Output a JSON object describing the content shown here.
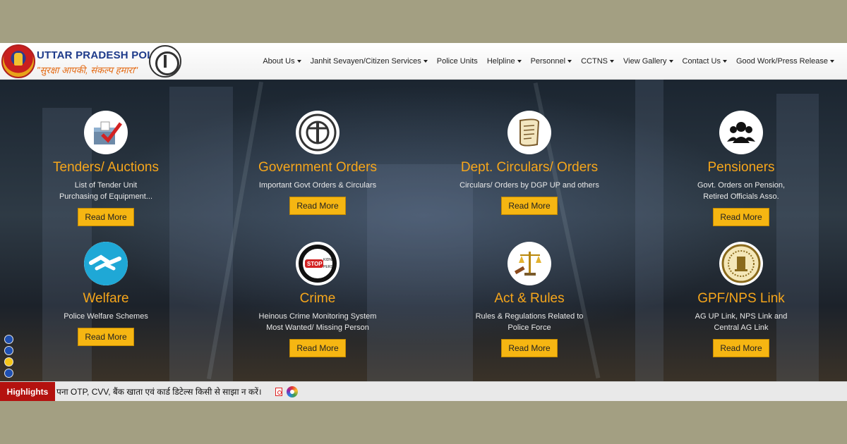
{
  "header": {
    "logo_title": "UTTAR PRADESH POLICE",
    "logo_tagline": "\"सुरक्षा आपकी, संकल्प हमारा\"",
    "nav": [
      {
        "label": "About Us",
        "dropdown": true
      },
      {
        "label": "Janhit Sevayen/Citizen Services",
        "dropdown": true
      },
      {
        "label": "Police Units",
        "dropdown": false
      },
      {
        "label": "Helpline",
        "dropdown": true
      },
      {
        "label": "Personnel",
        "dropdown": true
      },
      {
        "label": "CCTNS",
        "dropdown": true
      },
      {
        "label": "View Gallery",
        "dropdown": true
      },
      {
        "label": "Contact Us",
        "dropdown": true
      },
      {
        "label": "Good Work/Press Release",
        "dropdown": true
      }
    ]
  },
  "cards": [
    {
      "title": "Tenders/ Auctions",
      "desc": [
        "List of Tender Unit",
        "Purchasing of Equipment..."
      ],
      "button": "Read More",
      "icon": "ballot-box-icon"
    },
    {
      "title": "Government Orders",
      "desc": [
        "Important Govt Orders & Circulars"
      ],
      "button": "Read More",
      "icon": "police-seal-icon"
    },
    {
      "title": "Dept. Circulars/ Orders",
      "desc": [
        "Circulars/ Orders by DGP UP and others"
      ],
      "button": "Read More",
      "icon": "scroll-icon"
    },
    {
      "title": "Pensioners",
      "desc": [
        "Govt. Orders on Pension,",
        "Retired Officials Asso."
      ],
      "button": "Read More",
      "icon": "users-icon"
    },
    {
      "title": "Welfare",
      "desc": [
        "Police Welfare Schemes"
      ],
      "button": "Read More",
      "icon": "handshake-icon"
    },
    {
      "title": "Crime",
      "desc": [
        "Heinous Crime Monitoring System",
        "Most Wanted/ Missing Person"
      ],
      "button": "Read More",
      "icon": "stop-sign-icon"
    },
    {
      "title": "Act & Rules",
      "desc": [
        "Rules & Regulations Related to",
        "Police Force"
      ],
      "button": "Read More",
      "icon": "scales-gavel-icon"
    },
    {
      "title": "GPF/NPS Link",
      "desc": [
        "AG UP Link, NPS Link and",
        "Central AG Link"
      ],
      "button": "Read More",
      "icon": "emblem-seal-icon"
    }
  ],
  "slider_dots": 4,
  "slider_active": 3,
  "highlights": {
    "label": "Highlights",
    "text": "पना OTP, CVV, बैंक खाता एवं कार्ड डिटेल्स किसी से साझा न करें।"
  },
  "colors": {
    "accent": "#f6a61b",
    "button": "#f6b612",
    "highlight_red": "#b4120f",
    "brand_blue": "#1d3a8a"
  }
}
